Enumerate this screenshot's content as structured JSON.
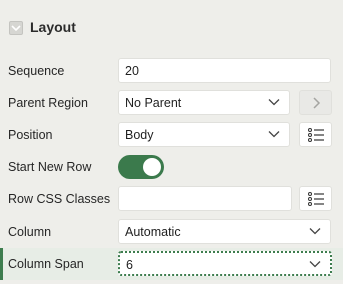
{
  "section": {
    "title": "Layout"
  },
  "fields": {
    "sequence": {
      "label": "Sequence",
      "value": "20"
    },
    "parent_region": {
      "label": "Parent Region",
      "value": "No Parent"
    },
    "position": {
      "label": "Position",
      "value": "Body"
    },
    "start_new_row": {
      "label": "Start New Row",
      "value": "on"
    },
    "row_css_classes": {
      "label": "Row CSS Classes",
      "value": ""
    },
    "column": {
      "label": "Column",
      "value": "Automatic"
    },
    "column_span": {
      "label": "Column Span",
      "value": "6"
    }
  },
  "colors": {
    "accent": "#3b7a4c",
    "panel_bg": "#eeeeea",
    "field_bg": "#ffffff"
  },
  "icons": {
    "collapse": "chevron-down-icon",
    "select": "chevron-down-icon",
    "go_to": "chevron-right-icon",
    "list_picker": "list-icon"
  }
}
